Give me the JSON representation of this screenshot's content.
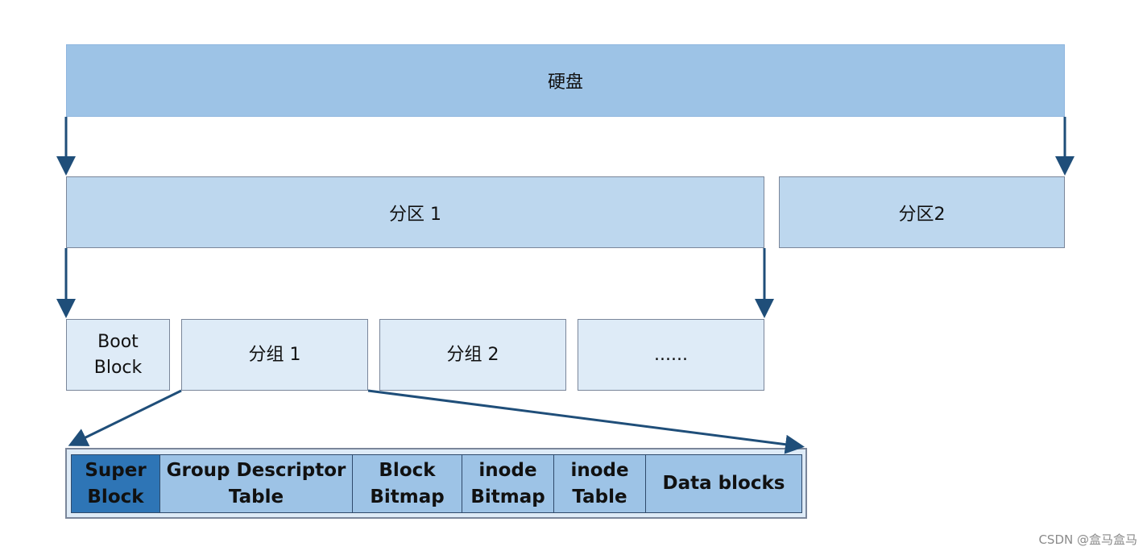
{
  "disk": {
    "label": "硬盘"
  },
  "partitions": [
    {
      "label": "分区 1"
    },
    {
      "label": "分区2"
    }
  ],
  "groups": [
    {
      "label": "Boot\nBlock"
    },
    {
      "label": "分组 1"
    },
    {
      "label": "分组 2"
    },
    {
      "label": "......"
    }
  ],
  "group_detail": [
    {
      "label": "Super\nBlock"
    },
    {
      "label": "Group Descriptor\nTable"
    },
    {
      "label": "Block\nBitmap"
    },
    {
      "label": "inode\nBitmap"
    },
    {
      "label": "inode\nTable"
    },
    {
      "label": "Data blocks"
    }
  ],
  "colors": {
    "disk": "#9dc3e6",
    "partition": "#bdd7ee",
    "group": "#deebf7",
    "super_block": "#2e75b6",
    "detail_cell": "#9dc3e6",
    "arrow": "#1f4e79"
  },
  "watermark": "CSDN @盒马盒马"
}
